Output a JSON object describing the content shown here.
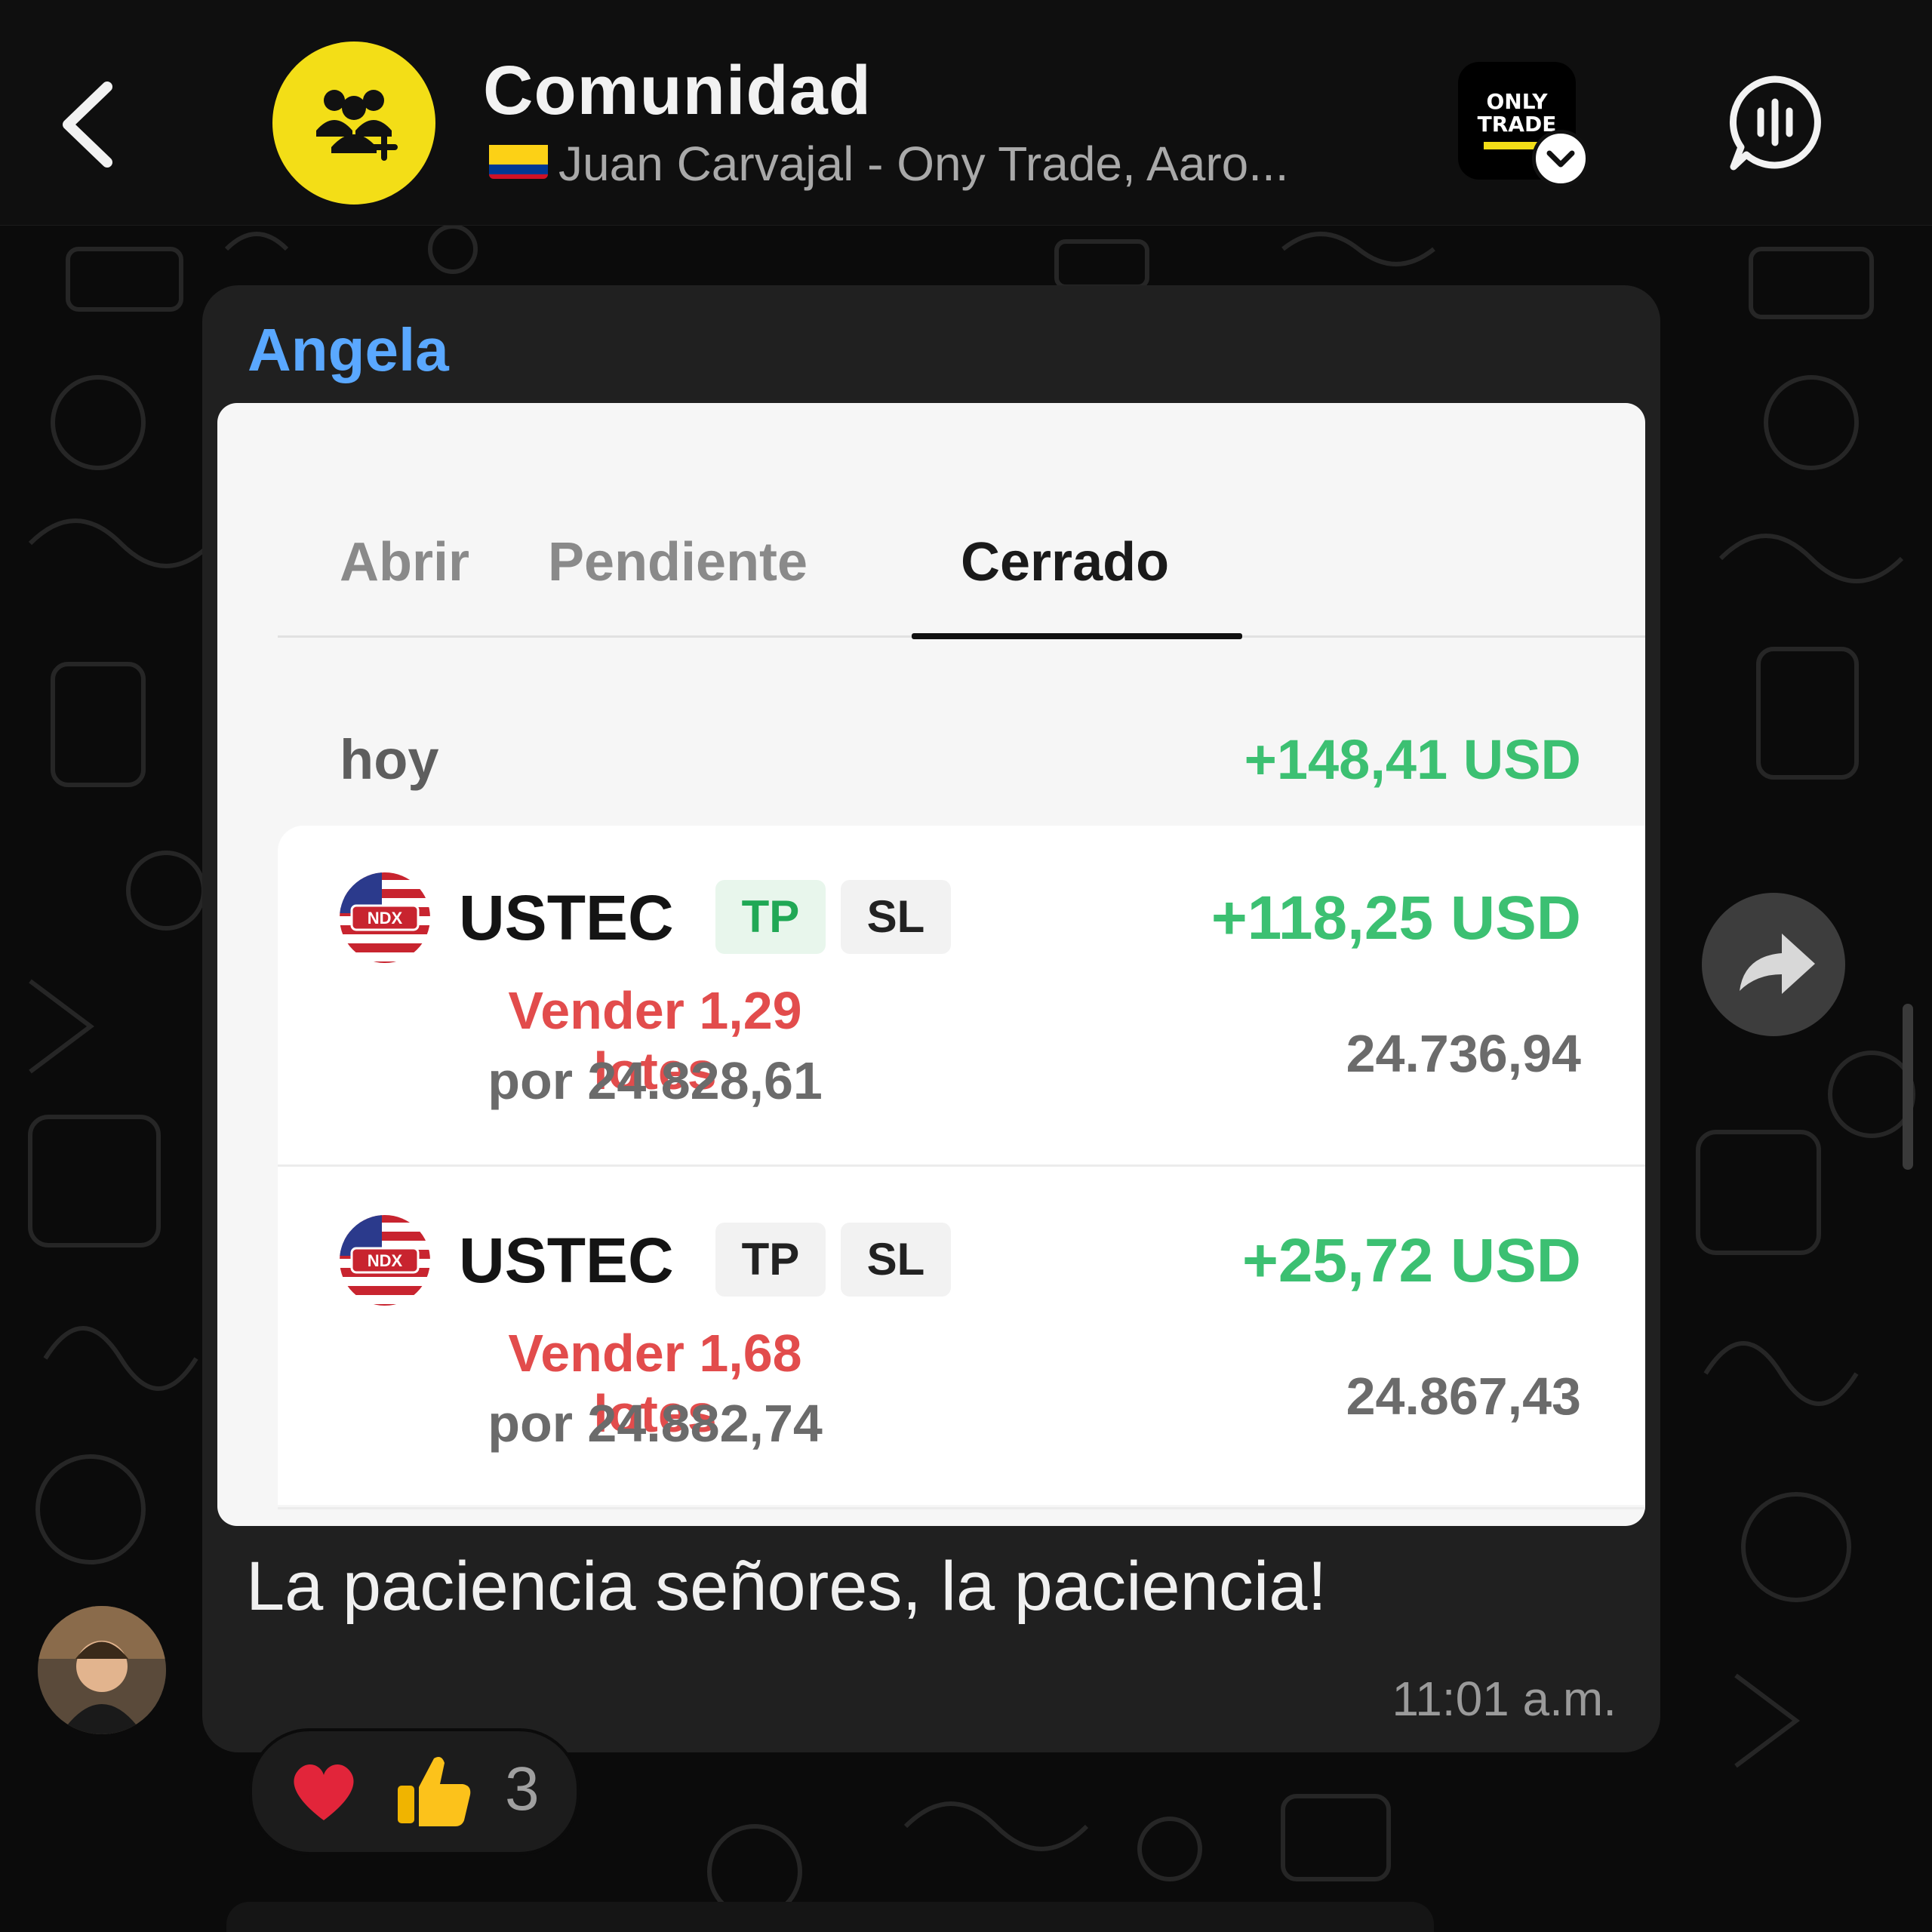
{
  "header": {
    "back_icon": "chevron-left",
    "title": "Comunidad",
    "subtitle": "Juan Carvajal - Ony Trade, Aaro...",
    "group_icon": "community-add-icon",
    "brand_logo_text": "ONLY TRADE",
    "voice_icon": "voice-chat-icon"
  },
  "message": {
    "sender": "Angela",
    "text": "La paciencia señores, la paciencia!",
    "time": "11:01 a.m.",
    "screenshot": {
      "tabs": [
        {
          "label": "Abrir",
          "active": false
        },
        {
          "label": "Pendiente",
          "active": false
        },
        {
          "label": "Cerrado",
          "active": true
        }
      ],
      "day_label": "hoy",
      "day_total": "+148,41 USD",
      "positions": [
        {
          "icon_label": "NDX",
          "symbol": "USTEC",
          "tp": "TP",
          "sl": "SL",
          "action": "Vender 1,29 lotes",
          "open_price": "por 24.828,61",
          "profit": "+118,25 USD",
          "close_price": "24.736,94"
        },
        {
          "icon_label": "NDX",
          "symbol": "USTEC",
          "tp": "TP",
          "sl": "SL",
          "action": "Vender 1,68 lotes",
          "open_price": "por 24.882,74",
          "profit": "+25,72 USD",
          "close_price": "24.867,43"
        }
      ]
    }
  },
  "reactions": {
    "items": [
      "heart",
      "thumbs-up"
    ],
    "count": "3"
  },
  "colors": {
    "accent_yellow": "#f3de17",
    "sender_blue": "#5aa8ff",
    "profit_green": "#3cc072",
    "sell_red": "#e24c4c"
  }
}
